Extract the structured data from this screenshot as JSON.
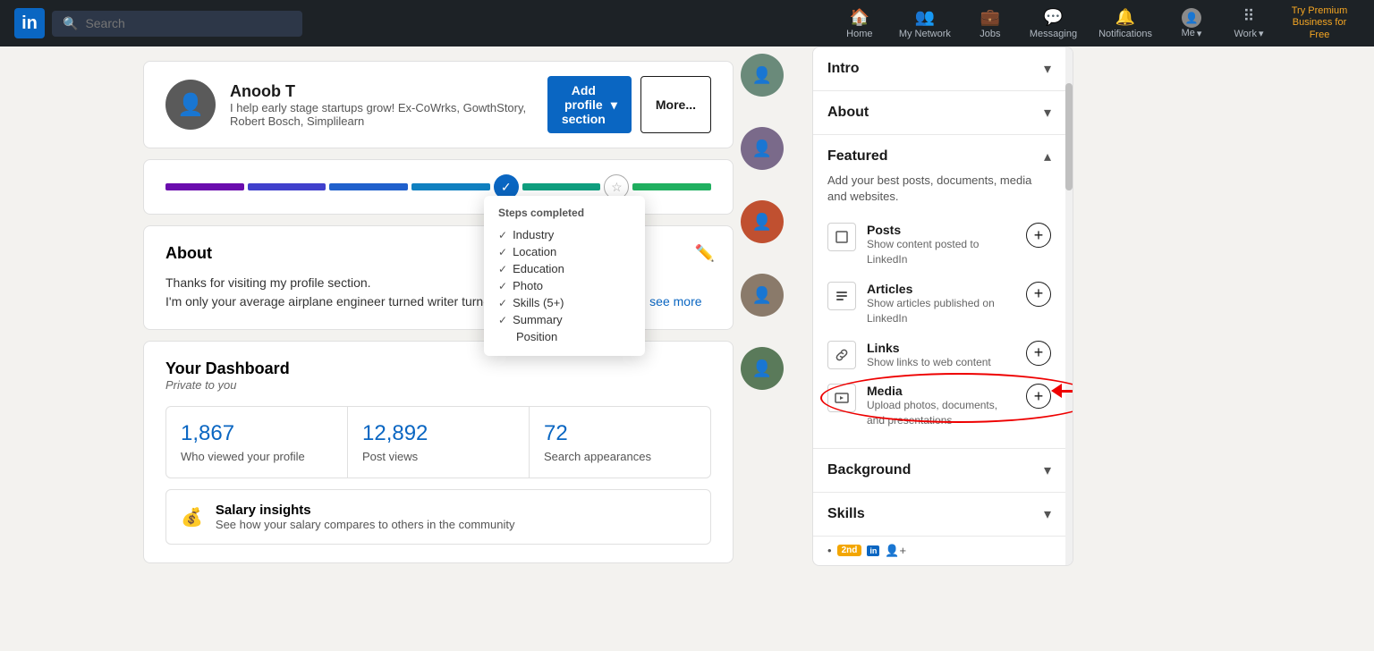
{
  "navbar": {
    "logo": "in",
    "search_placeholder": "Search",
    "nav_items": [
      {
        "id": "home",
        "label": "Home",
        "icon": "🏠"
      },
      {
        "id": "network",
        "label": "My Network",
        "icon": "👥"
      },
      {
        "id": "jobs",
        "label": "Jobs",
        "icon": "💼"
      },
      {
        "id": "messaging",
        "label": "Messaging",
        "icon": "💬"
      },
      {
        "id": "notifications",
        "label": "Notifications",
        "icon": "🔔"
      },
      {
        "id": "me",
        "label": "Me",
        "icon": "👤"
      },
      {
        "id": "work",
        "label": "Work",
        "icon": "⠿"
      }
    ],
    "premium_label": "Try Premium Business for Free"
  },
  "profile": {
    "name": "Anoob T",
    "tagline": "I help early stage startups grow! Ex-CoWrks, GowthStory, Robert Bosch, Simplilearn",
    "add_section_label": "Add profile section",
    "more_label": "More..."
  },
  "progress": {
    "steps_completed_label": "Steps completed",
    "steps": [
      {
        "label": "Industry",
        "done": true
      },
      {
        "label": "Location",
        "done": true
      },
      {
        "label": "Education",
        "done": true
      },
      {
        "label": "Photo",
        "done": true
      },
      {
        "label": "Skills (5+)",
        "done": true
      },
      {
        "label": "Summary",
        "done": true
      },
      {
        "label": "Position",
        "done": false
      }
    ]
  },
  "about": {
    "title": "About",
    "paragraph1": "Thanks for visiting my profile section.",
    "paragraph2": "I'm only your average airplane engineer turned writer turned (senior) digital marketer ...",
    "see_more": "see more"
  },
  "dashboard": {
    "title": "Your Dashboard",
    "subtitle": "Private to you",
    "stats": [
      {
        "number": "1,867",
        "label": "Who viewed your profile"
      },
      {
        "number": "12,892",
        "label": "Post views"
      },
      {
        "number": "72",
        "label": "Search appearances"
      }
    ],
    "salary_title": "Salary insights",
    "salary_desc": "See how your salary compares to others in the community"
  },
  "right_panel": {
    "sections": [
      {
        "id": "intro",
        "title": "Intro",
        "expanded": false
      },
      {
        "id": "about",
        "title": "About",
        "expanded": false
      },
      {
        "id": "featured",
        "title": "Featured",
        "expanded": true,
        "description": "Add your best posts, documents, media and websites.",
        "items": [
          {
            "id": "posts",
            "title": "Posts",
            "subtitle": "Show content posted to LinkedIn",
            "icon": "☐"
          },
          {
            "id": "articles",
            "title": "Articles",
            "subtitle": "Show articles published on LinkedIn",
            "icon": "≡"
          },
          {
            "id": "links",
            "title": "Links",
            "subtitle": "Show links to web content",
            "icon": "🔗"
          },
          {
            "id": "media",
            "title": "Media",
            "subtitle": "Upload photos, documents, and presentations",
            "icon": "🖼",
            "highlighted": true
          }
        ]
      },
      {
        "id": "background",
        "title": "Background",
        "expanded": false
      },
      {
        "id": "skills",
        "title": "Skills",
        "expanded": false
      }
    ],
    "bottom": {
      "badge": "2nd",
      "connect_icon": "person+"
    }
  }
}
